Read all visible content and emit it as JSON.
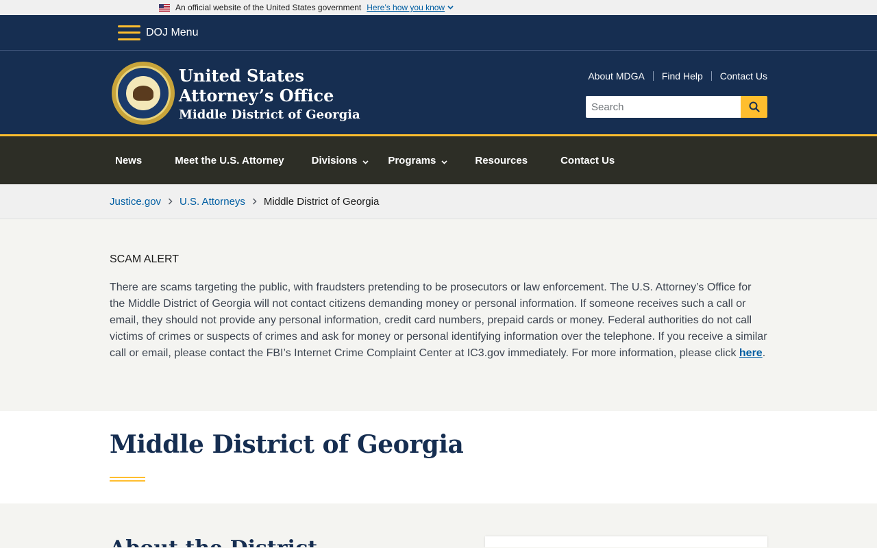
{
  "gov_banner": {
    "text": "An official website of the United States government",
    "link": "Here’s how you know"
  },
  "doj_menu": {
    "label": "DOJ Menu"
  },
  "header": {
    "title_line1": "United States",
    "title_line2": "Attorney’s Office",
    "subtitle": "Middle District of Georgia",
    "utility_links": [
      "About MDGA",
      "Find Help",
      "Contact Us"
    ],
    "search_placeholder": "Search"
  },
  "nav": {
    "items": [
      {
        "label": "News"
      },
      {
        "label": "Meet the U.S. Attorney"
      },
      {
        "label": "Divisions"
      },
      {
        "label": "Programs"
      },
      {
        "label": "Resources"
      },
      {
        "label": "Contact Us"
      }
    ]
  },
  "breadcrumb": {
    "items": [
      "Justice.gov",
      "U.S. Attorneys"
    ],
    "current": "Middle District of Georgia"
  },
  "alert": {
    "title": "SCAM ALERT",
    "body": "There are scams targeting the public, with fraudsters pretending to be prosecutors or law enforcement. The U.S. Attorney’s Office for the Middle District of Georgia will not contact citizens demanding money or personal information. If someone receives such a call or email, they should not provide any personal information, credit card numbers, prepaid cards or money. Federal authorities do not call victims of crimes or suspects of crimes and ask for money or personal identifying information over the telephone. If you receive a similar call or email, please contact the FBI’s Internet Crime Complaint Center at IC3.gov immediately. For more information, please click",
    "link": "here",
    "end": "."
  },
  "page": {
    "title": "Middle District of Georgia",
    "section_heading": "About the District"
  },
  "colors": {
    "navy": "#162e51",
    "gold": "#ffbe2e",
    "nav_bg": "#2d2e26",
    "link": "#005ea2"
  }
}
